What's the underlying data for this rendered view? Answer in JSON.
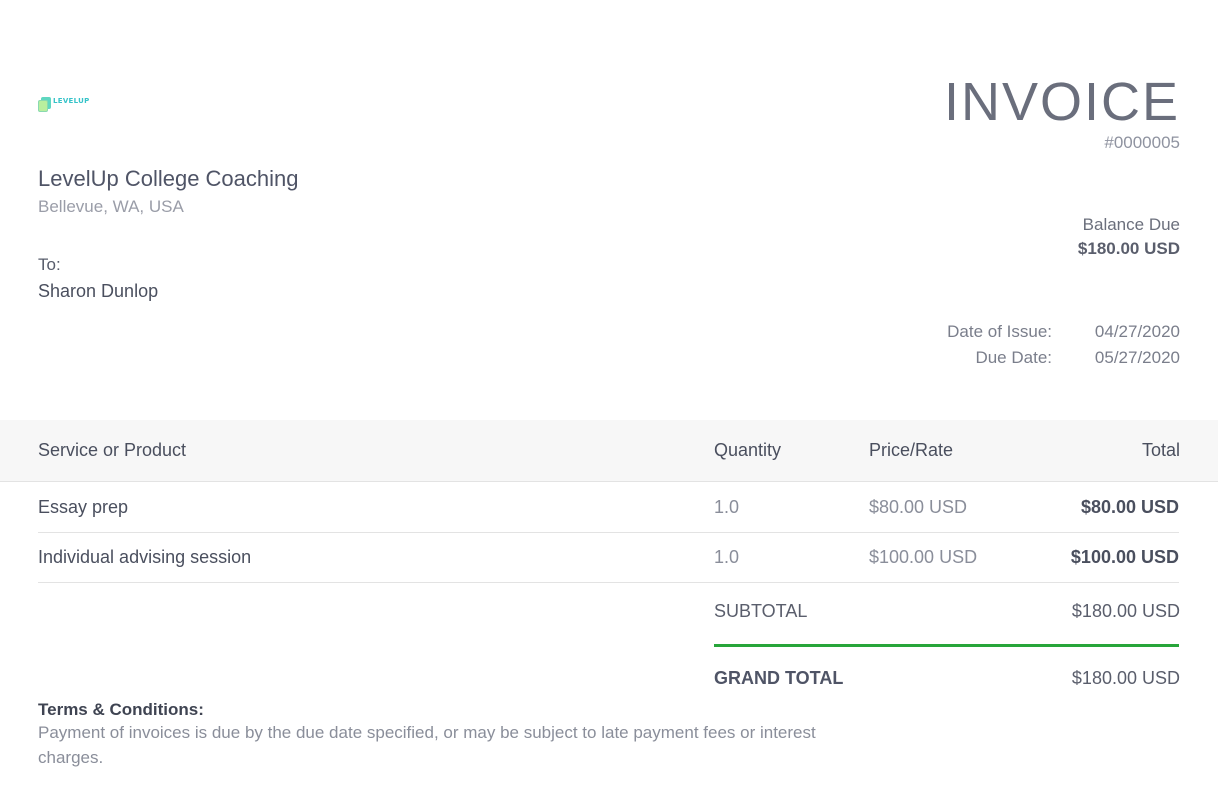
{
  "logo": {
    "text": "LEVELUP",
    "icon": "levelup-logo-icon"
  },
  "sender": {
    "name": "LevelUp College Coaching",
    "address": "Bellevue, WA, USA"
  },
  "recipient": {
    "label": "To:",
    "name": "Sharon Dunlop"
  },
  "invoice": {
    "title": "INVOICE",
    "number": "#0000005",
    "balance_label": "Balance Due",
    "balance_value": "$180.00 USD",
    "issue_label": "Date of Issue:",
    "issue_date": "04/27/2020",
    "due_label": "Due Date:",
    "due_date": "05/27/2020"
  },
  "table": {
    "headers": {
      "service": "Service or Product",
      "quantity": "Quantity",
      "price": "Price/Rate",
      "total": "Total"
    },
    "rows": [
      {
        "service": "Essay prep",
        "quantity": "1.0",
        "price": "$80.00 USD",
        "total": "$80.00 USD"
      },
      {
        "service": "Individual advising session",
        "quantity": "1.0",
        "price": "$100.00 USD",
        "total": "$100.00 USD"
      }
    ]
  },
  "totals": {
    "subtotal_label": "SUBTOTAL",
    "subtotal_value": "$180.00 USD",
    "grand_label": "GRAND TOTAL",
    "grand_value": "$180.00 USD",
    "accent_color": "#27a53a"
  },
  "terms": {
    "title": "Terms & Conditions:",
    "text": "Payment of invoices is due by the due date specified, or may be subject to late payment fees or interest charges."
  }
}
